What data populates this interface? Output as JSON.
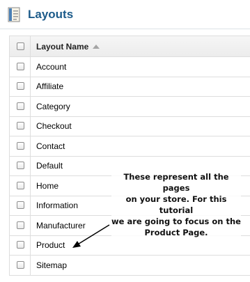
{
  "header": {
    "title": "Layouts",
    "icon": "layouts-page-icon"
  },
  "table": {
    "column_header": "Layout Name",
    "sort_direction": "ascending",
    "rows": [
      {
        "name": "Account"
      },
      {
        "name": "Affiliate"
      },
      {
        "name": "Category"
      },
      {
        "name": "Checkout"
      },
      {
        "name": "Contact"
      },
      {
        "name": "Default"
      },
      {
        "name": "Home"
      },
      {
        "name": "Information"
      },
      {
        "name": "Manufacturer"
      },
      {
        "name": "Product"
      },
      {
        "name": "Sitemap"
      }
    ]
  },
  "annotation": {
    "lines": [
      "These represent all the pages",
      "on your store. For this tutorial",
      "we are going to focus on the",
      "Product Page."
    ],
    "points_to": "Product"
  },
  "colors": {
    "title": "#1c5b8a",
    "border": "#dddddd",
    "arrow": "#000000"
  }
}
